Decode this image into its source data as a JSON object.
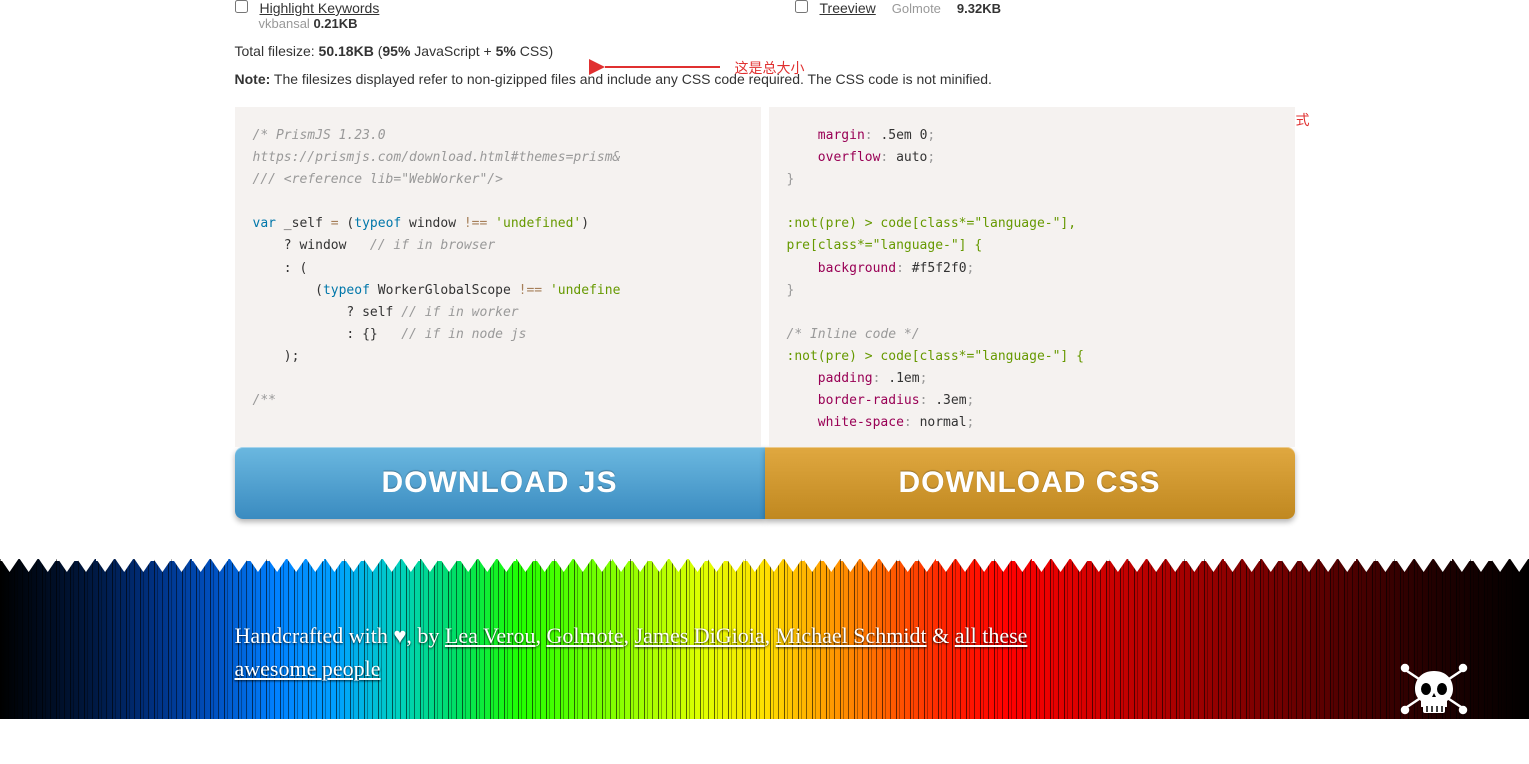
{
  "plugins": {
    "left": {
      "label": "Highlight Keywords",
      "author": "vkbansal",
      "size": "0.21KB"
    },
    "right": {
      "label": "Treeview",
      "author": "Golmote",
      "size": "9.32KB"
    }
  },
  "total": {
    "prefix": "Total filesize: ",
    "size": "50.18KB",
    "breakdown_open": " (",
    "js_pct": "95%",
    "js_label": " JavaScript + ",
    "css_pct": "5%",
    "css_label": " CSS)",
    "annotation": "这是总大小"
  },
  "note": {
    "label": "Note:",
    "text": " The filesizes displayed refer to non-gizipped files and include any CSS code required. The CSS code is not minified."
  },
  "style_annotation": "这是你代码高亮的样式",
  "code_left": {
    "l1": "/* PrismJS 1.23.0",
    "l2": "https://prismjs.com/download.html#themes=prism&",
    "l3": "/// <reference lib=\"WebWorker\"/>",
    "l4a": "var",
    "l4b": " _self ",
    "l4c": "=",
    "l4d": " (",
    "l4e": "typeof",
    "l4f": " window ",
    "l4g": "!==",
    "l4h": " 'undefined'",
    "l4i": ")",
    "l5a": "    ? ",
    "l5b": "window   ",
    "l5c": "// if in browser",
    "l6a": "    : (",
    "l7a": "        (",
    "l7b": "typeof",
    "l7c": " WorkerGlobalScope ",
    "l7d": "!==",
    "l7e": " 'undefine",
    "l8a": "            ? ",
    "l8b": "self ",
    "l8c": "// if in worker",
    "l9a": "            : {}   ",
    "l9b": "// if in node js",
    "l10": "    );",
    "l11": "/**"
  },
  "code_right": {
    "l1a": "    margin",
    "l1b": ": ",
    "l1c": ".5em 0",
    "l1d": ";",
    "l2a": "    overflow",
    "l2b": ": ",
    "l2c": "auto",
    "l2d": ";",
    "l3": "}",
    "l4": ":not(pre) > code[class*=\"language-\"],",
    "l5": "pre[class*=\"language-\"] {",
    "l6a": "    background",
    "l6b": ": ",
    "l6c": "#f5f2f0",
    "l6d": ";",
    "l7": "}",
    "l8": "/* Inline code */",
    "l9": ":not(pre) > code[class*=\"language-\"] {",
    "l10a": "    padding",
    "l10b": ": ",
    "l10c": ".1em",
    "l10d": ";",
    "l11a": "    border-radius",
    "l11b": ": ",
    "l11c": ".3em",
    "l11d": ";",
    "l12a": "    white-space",
    "l12b": ": ",
    "l12c": "normal",
    "l12d": ";"
  },
  "buttons": {
    "js": "DOWNLOAD JS",
    "css": "DOWNLOAD CSS"
  },
  "footer": {
    "prefix": "Handcrafted with ",
    "heart": "♥",
    "by": ", by ",
    "a1": "Lea Verou",
    "sep1": ", ",
    "a2": "Golmote",
    "sep2": ", ",
    "a3": "James DiGioia",
    "sep3": ", ",
    "a4": "Michael Schmidt",
    "amp": " & ",
    "a5": "all these awesome people"
  }
}
